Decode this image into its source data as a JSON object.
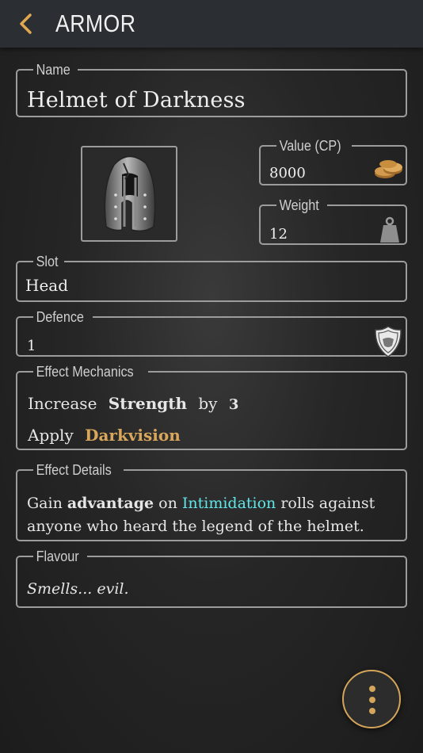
{
  "header": {
    "title": "ARMOR",
    "back_icon": "chevron-left-icon",
    "accent_color": "#e2a84f"
  },
  "name_field": {
    "label": "Name",
    "value": "Helmet of Darkness"
  },
  "portrait": {
    "icon": "helmet-image"
  },
  "value_field": {
    "label": "Value (CP)",
    "value": "8000",
    "icon": "coins-icon"
  },
  "weight_field": {
    "label": "Weight",
    "value": "12",
    "icon": "weight-icon"
  },
  "slot_field": {
    "label": "Slot",
    "value": "Head"
  },
  "defence_field": {
    "label": "Defence",
    "value": "1",
    "icon": "shield-icon"
  },
  "effect_mechanics": {
    "label": "Effect Mechanics",
    "row1": {
      "verb": "Increase",
      "stat": "Strength",
      "by": "by",
      "amount": "3"
    },
    "row2": {
      "verb": "Apply",
      "condition": "Darkvision"
    }
  },
  "effect_details": {
    "label": "Effect Details",
    "parts": [
      "Gain ",
      "advantage",
      " on ",
      "Intimidation",
      " rolls against anyone who heard the legend of the helmet."
    ],
    "highlight_color": "#5fe6e8"
  },
  "flavour": {
    "label": "Flavour",
    "text": "Smells... evil."
  },
  "fab": {
    "icon": "more-vertical-icon",
    "color": "#d4a55a"
  }
}
